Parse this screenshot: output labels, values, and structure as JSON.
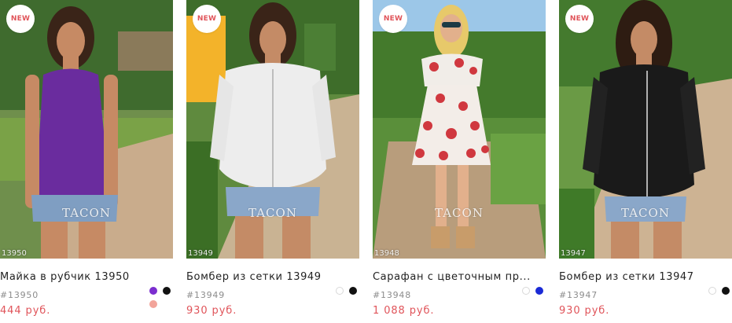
{
  "products": [
    {
      "badge": "NEW",
      "photo_code": "13950",
      "watermark": "TACON",
      "title": "Майка в рубчик 13950",
      "sku": "#13950",
      "price": "444 руб.",
      "swatches": [
        "#7b2ecf",
        "#111111",
        "#f2a49a"
      ]
    },
    {
      "badge": "NEW",
      "photo_code": "13949",
      "watermark": "TACON",
      "title": "Бомбер из сетки 13949",
      "sku": "#13949",
      "price": "930 руб.",
      "swatches": [
        "#ffffff",
        "#111111"
      ]
    },
    {
      "badge": "",
      "photo_code": "13948",
      "watermark": "TACON",
      "title": "Сарафан с цветочным пр...",
      "sku": "#13948",
      "price": "1 088 руб.",
      "swatches": [
        "#ffffff",
        "#1a2ad6"
      ]
    },
    {
      "badge": "NEW",
      "photo_code": "13947",
      "watermark": "TACON",
      "title": "Бомбер из сетки 13947",
      "sku": "#13947",
      "price": "930 руб.",
      "swatches": [
        "#ffffff",
        "#111111"
      ]
    }
  ]
}
